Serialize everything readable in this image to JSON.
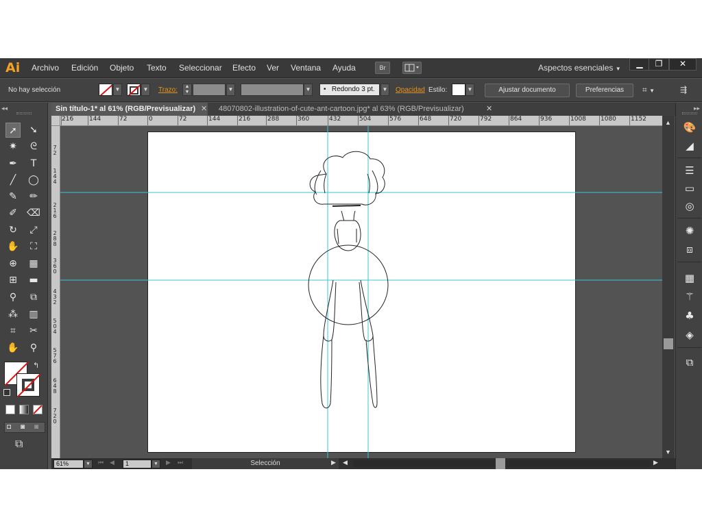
{
  "app": {
    "logo": "Ai",
    "menu": [
      "Archivo",
      "Edición",
      "Objeto",
      "Texto",
      "Seleccionar",
      "Efecto",
      "Ver",
      "Ventana",
      "Ayuda"
    ],
    "bridge_label": "Br",
    "workspace": "Aspectos esenciales",
    "window_buttons": [
      "minimize",
      "restore",
      "close"
    ]
  },
  "control_bar": {
    "selection_status": "No hay selección",
    "stroke_label": "Trazo:",
    "brush_label": "Redondo 3 pt.",
    "opacity_label": "Opacidad",
    "style_label": "Estilo:",
    "document_setup_button": "Ajustar documento",
    "preferences_button": "Preferencias",
    "fill_color": "#ffffff",
    "stroke_color": "#ffffff",
    "accent_color": "#e8931c"
  },
  "tabs": [
    {
      "label": "Sin título-1* al 61% (RGB/Previsualizar)",
      "active": true
    },
    {
      "label": "48070802-illustration-of-cute-ant-cartoon.jpg* al 63% (RGB/Previsualizar)",
      "active": false
    }
  ],
  "rulers": {
    "horizontal_labels": [
      "216",
      "144",
      "72",
      "0",
      "72",
      "144",
      "216",
      "288",
      "360",
      "432",
      "504",
      "576",
      "648",
      "720",
      "792",
      "864",
      "936",
      "1008",
      "1080",
      "1152"
    ],
    "vertical_labels": [
      "7\n2",
      "1\n4\n4",
      "2\n1\n6",
      "2\n8\n8",
      "3\n6\n0",
      "4\n3\n2",
      "5\n0\n4",
      "5\n7\n6",
      "6\n4\n8",
      "7\n2\n0"
    ]
  },
  "canvas": {
    "guide_color": "#39c8d8",
    "artboard_color": "#ffffff",
    "drawing": "ant-sketch"
  },
  "tools": {
    "icons": [
      "selection-tool-icon",
      "direct-selection-tool-icon",
      "magic-wand-tool-icon",
      "lasso-tool-icon",
      "pen-tool-icon",
      "type-tool-icon",
      "line-tool-icon",
      "ellipse-tool-icon",
      "paintbrush-tool-icon",
      "pencil-tool-icon",
      "blob-brush-tool-icon",
      "eraser-tool-icon",
      "rotate-tool-icon",
      "scale-tool-icon",
      "warp-tool-icon",
      "free-transform-tool-icon",
      "shape-builder-tool-icon",
      "perspective-grid-tool-icon",
      "mesh-tool-icon",
      "gradient-tool-icon",
      "eyedropper-tool-icon",
      "blend-tool-icon",
      "symbol-sprayer-tool-icon",
      "column-graph-tool-icon",
      "artboard-tool-icon",
      "slice-tool-icon",
      "hand-tool-icon",
      "zoom-tool-icon"
    ]
  },
  "right_panel": {
    "icons": [
      "color-panel-icon",
      "color-guide-icon",
      "stroke-panel-icon",
      "gradient-panel-icon",
      "transparency-panel-icon",
      "appearance-panel-icon",
      "graphic-styles-icon",
      "swatches-panel-icon",
      "brushes-panel-icon",
      "symbols-panel-icon",
      "layers-panel-icon",
      "artboards-panel-icon"
    ]
  },
  "status_bar": {
    "zoom": "61%",
    "artboard_number": "1",
    "current_tool": "Selección"
  }
}
